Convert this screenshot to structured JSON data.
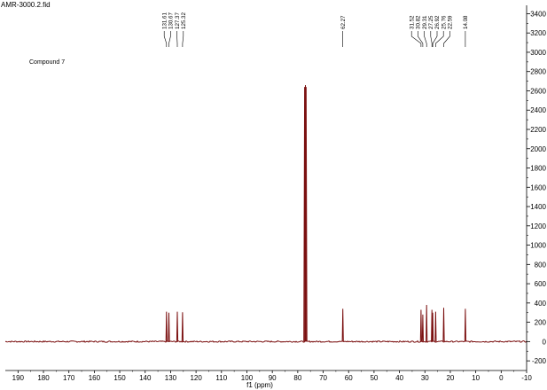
{
  "file_label": "AMR-3000.2.fid",
  "annotation": "Compound 7",
  "chart_data": {
    "type": "line",
    "title": "",
    "xlabel": "f1 (ppm)",
    "ylabel": "",
    "xlim": [
      195,
      -10
    ],
    "ylim": [
      -300,
      3450
    ],
    "x_reversed": true,
    "x_ticks": [
      190,
      180,
      170,
      160,
      150,
      140,
      130,
      120,
      110,
      100,
      90,
      80,
      70,
      60,
      50,
      40,
      30,
      20,
      10,
      0,
      -10
    ],
    "y_ticks": [
      -200,
      0,
      200,
      400,
      600,
      800,
      1000,
      1200,
      1400,
      1600,
      1800,
      2000,
      2200,
      2400,
      2600,
      2800,
      3000,
      3200,
      3400
    ],
    "y_axis_side": "right",
    "grid": false,
    "line_color": "#7b1010",
    "baseline": 0,
    "peaks": [
      {
        "ppm": 131.61,
        "height": 310
      },
      {
        "ppm": 130.67,
        "height": 300
      },
      {
        "ppm": 127.37,
        "height": 310
      },
      {
        "ppm": 125.32,
        "height": 305
      },
      {
        "ppm": 77.3,
        "height": 2640
      },
      {
        "ppm": 77.0,
        "height": 2660
      },
      {
        "ppm": 76.7,
        "height": 2640
      },
      {
        "ppm": 62.27,
        "height": 340
      },
      {
        "ppm": 31.52,
        "height": 330
      },
      {
        "ppm": 30.82,
        "height": 280
      },
      {
        "ppm": 29.31,
        "height": 380
      },
      {
        "ppm": 27.25,
        "height": 330
      },
      {
        "ppm": 26.92,
        "height": 300
      },
      {
        "ppm": 25.76,
        "height": 310
      },
      {
        "ppm": 22.59,
        "height": 350
      },
      {
        "ppm": 14.08,
        "height": 340
      }
    ],
    "peak_label_groups": [
      {
        "labels": [
          "131.61",
          "130.67",
          "127.37",
          "125.32"
        ]
      },
      {
        "labels": [
          "62.27"
        ]
      },
      {
        "labels": [
          "31.52",
          "30.82",
          "29.31",
          "27.25",
          "26.92",
          "25.76",
          "22.59"
        ]
      },
      {
        "labels": [
          "14.08"
        ]
      }
    ]
  }
}
